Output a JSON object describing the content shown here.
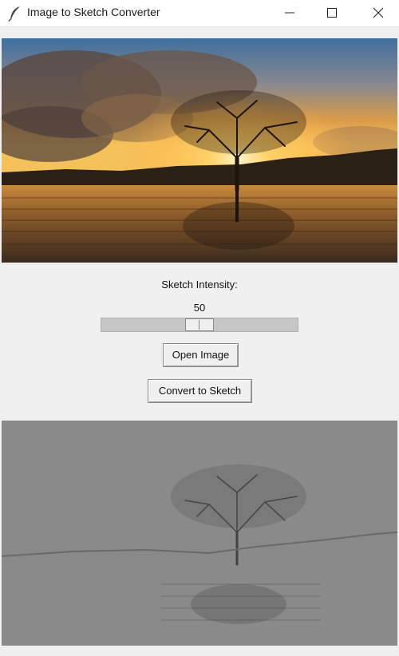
{
  "window": {
    "title": "Image to Sketch Converter",
    "icon": "feather-icon"
  },
  "controls": {
    "intensity_label": "Sketch Intensity:",
    "intensity_value": "50",
    "intensity_fraction": 0.5,
    "open_button": "Open Image",
    "convert_button": "Convert to Sketch"
  },
  "colors": {
    "background": "#f0f0f0",
    "sketch_gray": "#8a8a8a"
  }
}
